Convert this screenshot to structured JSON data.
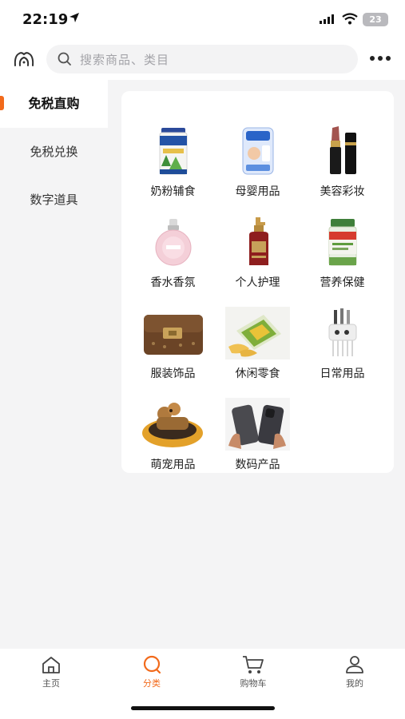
{
  "status_bar": {
    "time": "22:19",
    "battery": "23"
  },
  "search": {
    "placeholder": "搜索商品、类目"
  },
  "sidebar": {
    "items": [
      {
        "label": "免税直购",
        "active": true
      },
      {
        "label": "免税兑换",
        "active": false
      },
      {
        "label": "数字道具",
        "active": false
      }
    ]
  },
  "categories": [
    {
      "label": "奶粉辅食",
      "icon": "milk-powder-can"
    },
    {
      "label": "母婴用品",
      "icon": "diaper-pack"
    },
    {
      "label": "美容彩妆",
      "icon": "lipstick"
    },
    {
      "label": "香水香氛",
      "icon": "perfume-bottle"
    },
    {
      "label": "个人护理",
      "icon": "shampoo-bottle"
    },
    {
      "label": "营养保健",
      "icon": "supplement-jar"
    },
    {
      "label": "服装饰品",
      "icon": "handbag"
    },
    {
      "label": "休闲零食",
      "icon": "snack-bag"
    },
    {
      "label": "日常用品",
      "icon": "toothbrush-holder"
    },
    {
      "label": "萌宠用品",
      "icon": "pet-bed"
    },
    {
      "label": "数码产品",
      "icon": "smartphones"
    }
  ],
  "tabbar": {
    "items": [
      {
        "label": "主页",
        "icon": "home-icon",
        "active": false
      },
      {
        "label": "分类",
        "icon": "category-icon",
        "active": true
      },
      {
        "label": "购物车",
        "icon": "cart-icon",
        "active": false
      },
      {
        "label": "我的",
        "icon": "profile-icon",
        "active": false
      }
    ]
  },
  "colors": {
    "accent": "#f26a1b",
    "background": "#f4f4f5",
    "card": "#ffffff"
  }
}
